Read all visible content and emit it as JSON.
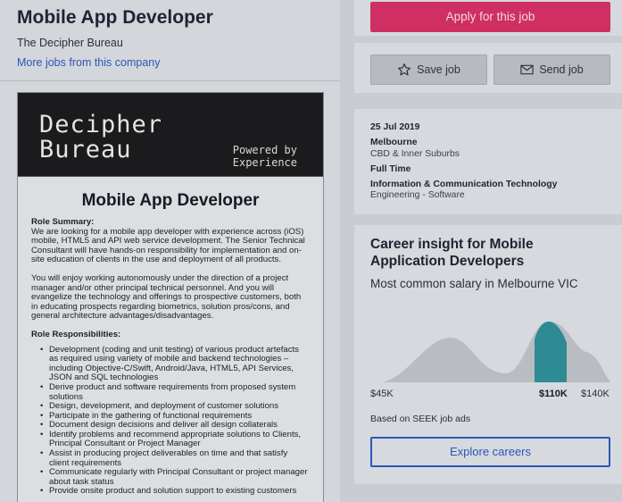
{
  "job": {
    "title": "Mobile App Developer",
    "company": "The Decipher Bureau",
    "more_jobs": "More jobs from this company"
  },
  "ad": {
    "logo_line1": "Decipher",
    "logo_line2": "Bureau",
    "powered_line1": "Powered by",
    "powered_line2": "Experience",
    "heading": "Mobile App Developer",
    "summary_heading": "Role Summary:",
    "summary_p1": "We are looking for a mobile app developer with experience across (iOS) mobile, HTML5 and API web service development. The Senior Technical Consultant will have hands-on responsibility for implementation and on-site education of clients in the use and deployment of all products.",
    "summary_p2": "You will enjoy working autonomously under the direction of a project manager and/or other principal technical personnel.  And you will evangelize the technology and offerings to prospective customers, both in educating prospects regarding biometrics, solution pros/cons, and general architecture advantages/disadvantages.",
    "resp_heading": "Role Responsibilities:",
    "responsibilities": [
      "Development (coding and unit testing) of various product artefacts as required using variety of mobile and backend technologies – including Objective-C/Swift, Android/Java, HTML5, API Services, JSON and SQL technologies",
      "Derive product and software requirements from proposed system solutions",
      "Design, development, and deployment of customer solutions",
      "Participate in the gathering of functional requirements",
      "Document design decisions and deliver all design collaterals",
      "Identify problems and recommend appropriate solutions to Clients, Principal Consultant or Project Manager",
      "Assist in producing project deliverables on time and that satisfy client requirements",
      "Communicate regularly with Principal Consultant or project manager about task status",
      "Provide onsite product and solution support to existing customers"
    ]
  },
  "actions": {
    "apply": "Apply for this job",
    "save": "Save job",
    "send": "Send job"
  },
  "details": {
    "date": "25 Jul 2019",
    "location": "Melbourne",
    "area": "CBD & Inner Suburbs",
    "work_type": "Full Time",
    "classification": "Information & Communication Technology",
    "sub_classification": "Engineering - Software"
  },
  "insight": {
    "title": "Career insight for Mobile Application Developers",
    "subtitle": "Most common salary in Melbourne VIC",
    "salary_low": "$45K",
    "salary_common": "$110K",
    "salary_high": "$140K",
    "based_on": "Based on SEEK job ads",
    "explore": "Explore careers",
    "highlight_color": "#2e8a93"
  }
}
